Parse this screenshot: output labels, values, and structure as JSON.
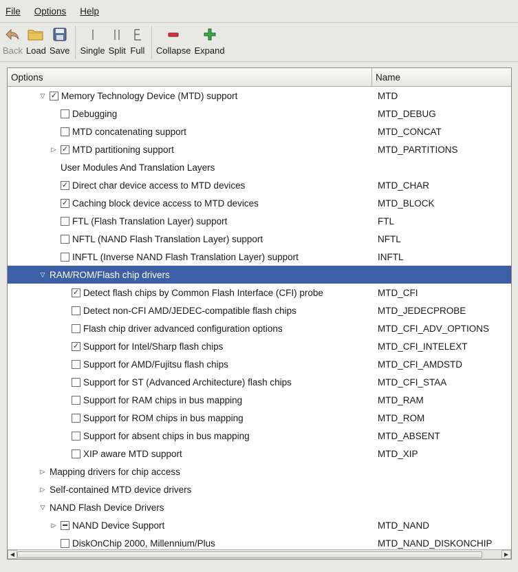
{
  "menu": {
    "file": "File",
    "options": "Options",
    "help": "Help"
  },
  "toolbar": {
    "back": "Back",
    "load": "Load",
    "save": "Save",
    "single": "Single",
    "split": "Split",
    "full": "Full",
    "collapse": "Collapse",
    "expand": "Expand"
  },
  "tree": {
    "columns": {
      "options": "Options",
      "name": "Name"
    },
    "rows": [
      {
        "label": "Memory Technology Device (MTD) support",
        "name": "MTD",
        "depth": 1,
        "expander": "open",
        "check": "checked"
      },
      {
        "label": "Debugging",
        "name": "MTD_DEBUG",
        "depth": 2,
        "expander": "none",
        "check": "unchecked"
      },
      {
        "label": "MTD concatenating support",
        "name": "MTD_CONCAT",
        "depth": 2,
        "expander": "none",
        "check": "unchecked"
      },
      {
        "label": "MTD partitioning support",
        "name": "MTD_PARTITIONS",
        "depth": 2,
        "expander": "closed",
        "check": "checked"
      },
      {
        "label": "User Modules And Translation Layers",
        "name": "",
        "depth": 2,
        "expander": "none",
        "check": "none"
      },
      {
        "label": "Direct char device access to MTD devices",
        "name": "MTD_CHAR",
        "depth": 2,
        "expander": "none",
        "check": "checked"
      },
      {
        "label": "Caching block device access to MTD devices",
        "name": "MTD_BLOCK",
        "depth": 2,
        "expander": "none",
        "check": "checked"
      },
      {
        "label": "FTL (Flash Translation Layer) support",
        "name": "FTL",
        "depth": 2,
        "expander": "none",
        "check": "unchecked"
      },
      {
        "label": "NFTL (NAND Flash Translation Layer) support",
        "name": "NFTL",
        "depth": 2,
        "expander": "none",
        "check": "unchecked"
      },
      {
        "label": "INFTL (Inverse NAND Flash Translation Layer) support",
        "name": "INFTL",
        "depth": 2,
        "expander": "none",
        "check": "unchecked"
      },
      {
        "label": "RAM/ROM/Flash chip drivers",
        "name": "",
        "depth": 1,
        "expander": "open",
        "check": "none",
        "selected": true
      },
      {
        "label": "Detect flash chips by Common Flash Interface (CFI) probe",
        "name": "MTD_CFI",
        "depth": 3,
        "expander": "none",
        "check": "checked"
      },
      {
        "label": "Detect non-CFI AMD/JEDEC-compatible flash chips",
        "name": "MTD_JEDECPROBE",
        "depth": 3,
        "expander": "none",
        "check": "unchecked"
      },
      {
        "label": "Flash chip driver advanced configuration options",
        "name": "MTD_CFI_ADV_OPTIONS",
        "depth": 3,
        "expander": "none",
        "check": "unchecked"
      },
      {
        "label": "Support for Intel/Sharp flash chips",
        "name": "MTD_CFI_INTELEXT",
        "depth": 3,
        "expander": "none",
        "check": "checked"
      },
      {
        "label": "Support for AMD/Fujitsu flash chips",
        "name": "MTD_CFI_AMDSTD",
        "depth": 3,
        "expander": "none",
        "check": "unchecked"
      },
      {
        "label": "Support for ST (Advanced Architecture) flash chips",
        "name": "MTD_CFI_STAA",
        "depth": 3,
        "expander": "none",
        "check": "unchecked"
      },
      {
        "label": "Support for RAM chips in bus mapping",
        "name": "MTD_RAM",
        "depth": 3,
        "expander": "none",
        "check": "unchecked"
      },
      {
        "label": "Support for ROM chips in bus mapping",
        "name": "MTD_ROM",
        "depth": 3,
        "expander": "none",
        "check": "unchecked"
      },
      {
        "label": "Support for absent chips in bus mapping",
        "name": "MTD_ABSENT",
        "depth": 3,
        "expander": "none",
        "check": "unchecked"
      },
      {
        "label": "XIP aware MTD support",
        "name": "MTD_XIP",
        "depth": 3,
        "expander": "none",
        "check": "unchecked"
      },
      {
        "label": "Mapping drivers for chip access",
        "name": "",
        "depth": 1,
        "expander": "closed",
        "check": "none"
      },
      {
        "label": "Self-contained MTD device drivers",
        "name": "",
        "depth": 1,
        "expander": "closed",
        "check": "none"
      },
      {
        "label": "NAND Flash Device Drivers",
        "name": "",
        "depth": 1,
        "expander": "open",
        "check": "none"
      },
      {
        "label": "NAND Device Support",
        "name": "MTD_NAND",
        "depth": 2,
        "expander": "closed",
        "check": "mixed"
      },
      {
        "label": "DiskOnChip 2000, Millennium/Plus",
        "name": "MTD_NAND_DISKONCHIP",
        "depth": 2,
        "expander": "none",
        "check": "unchecked"
      }
    ]
  },
  "colors": {
    "selection": "#3d5fa6",
    "window": "#e8e8e4",
    "tree_bg": "#ffffff"
  }
}
